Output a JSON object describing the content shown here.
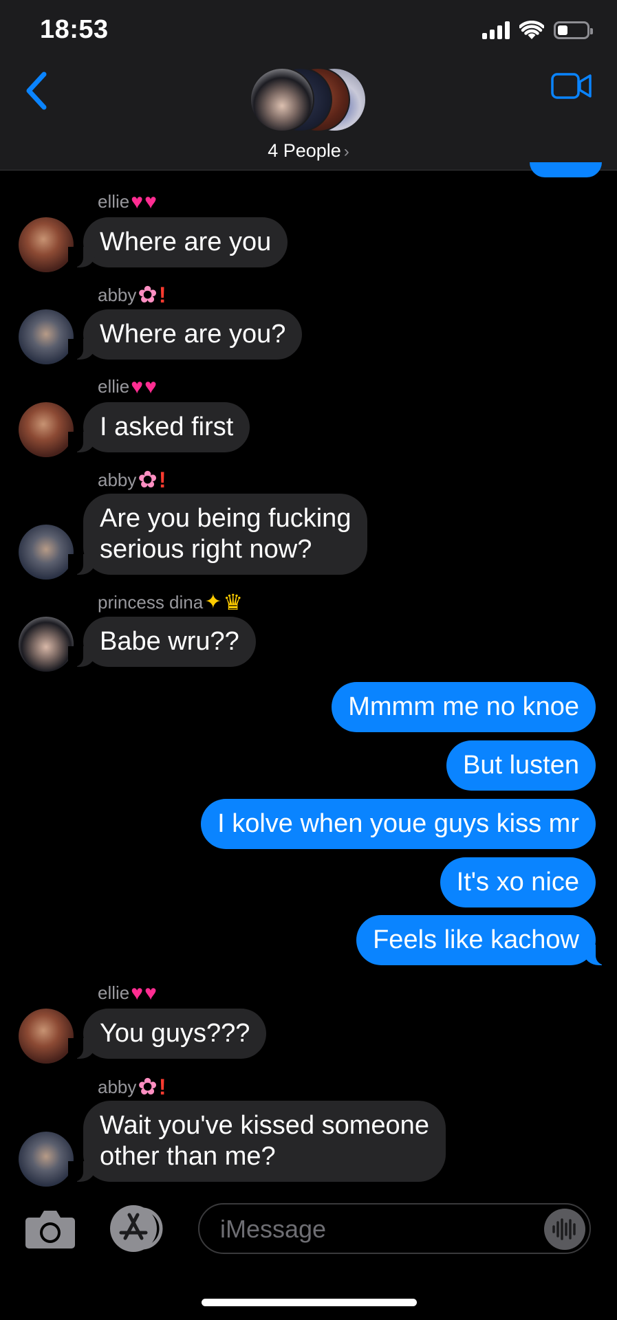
{
  "status_bar": {
    "time": "18:53",
    "battery_level": 0.35
  },
  "header": {
    "group_name": "4 People",
    "chevron": "›",
    "back_icon": "chevron-left-icon",
    "video_icon": "video-camera-icon"
  },
  "messages": [
    {
      "sender": "ellie",
      "sender_emoji": [
        "heart",
        "heart"
      ],
      "text": "Where are you"
    },
    {
      "sender": "abby",
      "sender_emoji": [
        "flower",
        "exclamation"
      ],
      "text": "Where are you?"
    },
    {
      "sender": "ellie",
      "sender_emoji": [
        "heart",
        "heart"
      ],
      "text": "I asked first"
    },
    {
      "sender": "abby",
      "sender_emoji": [
        "flower",
        "exclamation"
      ],
      "lines": [
        "Are you being fucking",
        "serious right now?"
      ]
    },
    {
      "sender": "princess dina",
      "sender_emoji": [
        "sparkle",
        "crown"
      ],
      "text": "Babe wru??"
    },
    {
      "sender": "me",
      "text": "Mmmm me no knoe"
    },
    {
      "sender": "me",
      "text": "But lusten"
    },
    {
      "sender": "me",
      "text": "I kolve when youe guys kiss mr"
    },
    {
      "sender": "me",
      "text": "It's xo nice"
    },
    {
      "sender": "me",
      "text": "Feels like kachow"
    },
    {
      "sender": "ellie",
      "sender_emoji": [
        "heart",
        "heart"
      ],
      "text": "You guys???"
    },
    {
      "sender": "abby",
      "sender_emoji": [
        "flower",
        "exclamation"
      ],
      "lines": [
        "Wait you've kissed someone",
        "other than me?"
      ]
    }
  ],
  "composer": {
    "placeholder": "iMessage",
    "value": "",
    "camera_icon": "camera-icon",
    "apps_icon": "app-store-icon",
    "audio_icon": "audio-waveform-icon"
  },
  "colors": {
    "outgoing_bubble": "#0a84ff",
    "incoming_bubble": "#262628",
    "header_bg": "#1c1c1e",
    "accent": "#0a84ff"
  }
}
